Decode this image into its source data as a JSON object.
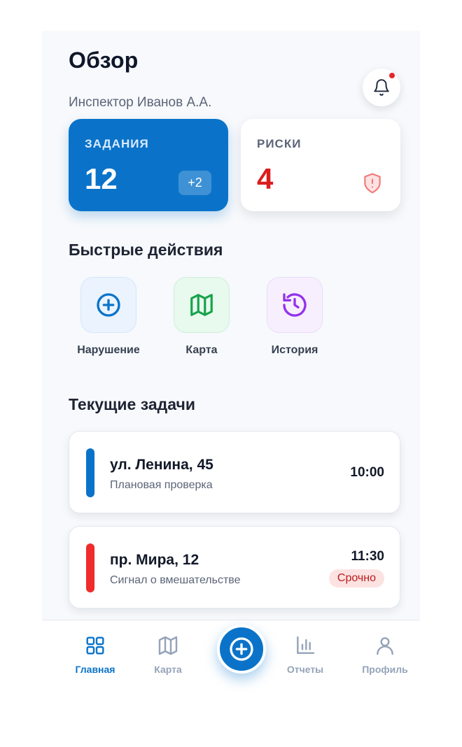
{
  "header": {
    "title": "Обзор",
    "subtitle": "Инспектор Иванов А.А.",
    "has_notification": true
  },
  "stats": {
    "tasks": {
      "label": "ЗАДАНИЯ",
      "value": "12",
      "badge": "+2"
    },
    "risks": {
      "label": "РИСКИ",
      "value": "4"
    }
  },
  "quick_actions": {
    "title": "Быстрые действия",
    "items": [
      {
        "label": "Нарушение",
        "icon": "plus-circle-icon",
        "color": "#0a73c9"
      },
      {
        "label": "Карта",
        "icon": "map-icon",
        "color": "#16a34a"
      },
      {
        "label": "История",
        "icon": "history-icon",
        "color": "#9333ea"
      }
    ]
  },
  "current_tasks": {
    "title": "Текущие задачи",
    "items": [
      {
        "address": "ул. Ленина, 45",
        "description": "Плановая проверка",
        "time": "10:00",
        "color": "#0a73c9"
      },
      {
        "address": "пр. Мира, 12",
        "description": "Сигнал о вмешательстве",
        "time": "11:30",
        "tag": "Срочно",
        "color": "#ef2b2b"
      }
    ]
  },
  "nav": {
    "items": [
      {
        "label": "Главная",
        "icon": "grid-icon",
        "active": true
      },
      {
        "label": "Карта",
        "icon": "map-icon"
      },
      {
        "label": "Отчеты",
        "icon": "bar-chart-icon"
      },
      {
        "label": "Профиль",
        "icon": "user-icon"
      }
    ],
    "fab_icon": "plus-circle-icon"
  },
  "colors": {
    "primary": "#0a73c9",
    "danger": "#dc1d1d",
    "background": "#f7f9fc"
  }
}
